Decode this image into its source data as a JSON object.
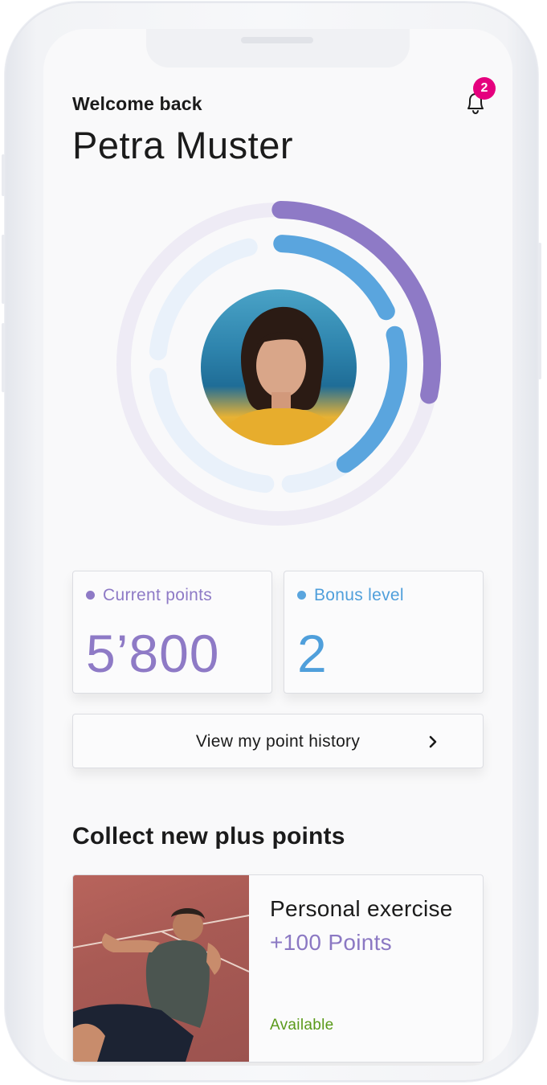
{
  "header": {
    "welcome": "Welcome back",
    "name": "Petra Muster",
    "notification_count": "2"
  },
  "progress_rings": {
    "outer": {
      "fraction": 0.21,
      "color": "#8e7ac6"
    },
    "inner": {
      "fraction": 0.42,
      "color": "#5aa5de"
    }
  },
  "stats": {
    "points_label": "Current points",
    "points_value": "5’800",
    "points_color": "#8e7ac6",
    "level_label": "Bonus level",
    "level_value": "2",
    "level_color": "#4f9fdb"
  },
  "history_button": {
    "label": "View my point history",
    "icon": "chevron-right-icon"
  },
  "section": {
    "title": "Collect new plus points"
  },
  "offer": {
    "title": "Personal exercise",
    "points": "+100 Points",
    "status": "Available"
  },
  "colors": {
    "badge": "#e5007e",
    "available": "#5a9a1a"
  }
}
